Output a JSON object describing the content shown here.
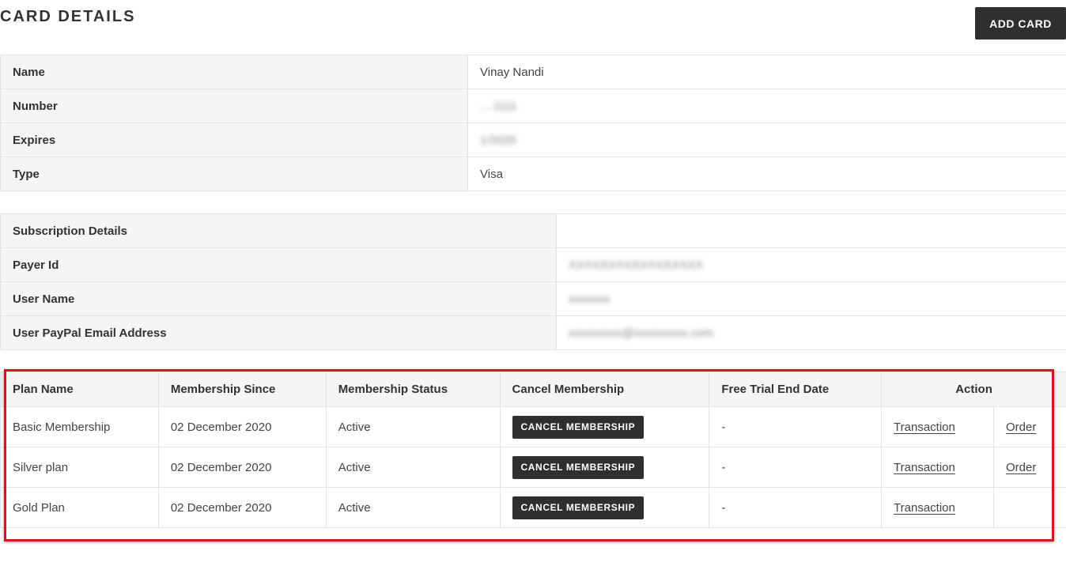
{
  "header": {
    "title": "CARD DETAILS",
    "add_card_label": "ADD CARD"
  },
  "card": {
    "rows": [
      {
        "label": "Name",
        "value": "Vinay Nandi",
        "masked": false
      },
      {
        "label": "Number",
        "value": "....1111",
        "masked": true
      },
      {
        "label": "Expires",
        "value": "1/2025",
        "masked": true
      },
      {
        "label": "Type",
        "value": "Visa",
        "masked": false
      }
    ]
  },
  "subscription": {
    "rows": [
      {
        "label": "Subscription Details",
        "value": "",
        "masked": false
      },
      {
        "label": "Payer Id",
        "value": "XXXXXXXXXXXXXXXXX",
        "masked": true
      },
      {
        "label": "User Name",
        "value": "xxxxxxx",
        "masked": true
      },
      {
        "label": "User PayPal Email Address",
        "value": "xxxxxxxxx@xxxxxxxxx.com",
        "masked": true
      }
    ]
  },
  "plans": {
    "headers": [
      "Plan Name",
      "Membership Since",
      "Membership Status",
      "Cancel Membership",
      "Free Trial End Date",
      "Action"
    ],
    "cancel_label": "CANCEL MEMBERSHIP",
    "transaction_label": "Transaction",
    "order_label": "Order",
    "rows": [
      {
        "plan": "Basic Membership",
        "since": "02 December 2020",
        "status": "Active",
        "trial_end": "-",
        "has_order": true
      },
      {
        "plan": "Silver plan",
        "since": "02 December 2020",
        "status": "Active",
        "trial_end": "-",
        "has_order": true
      },
      {
        "plan": "Gold Plan",
        "since": "02 December 2020",
        "status": "Active",
        "trial_end": "-",
        "has_order": false
      }
    ]
  },
  "colors": {
    "highlight": "#d6151c",
    "status_active": "#1f8a1f",
    "button_bg": "#2f2f2f"
  }
}
